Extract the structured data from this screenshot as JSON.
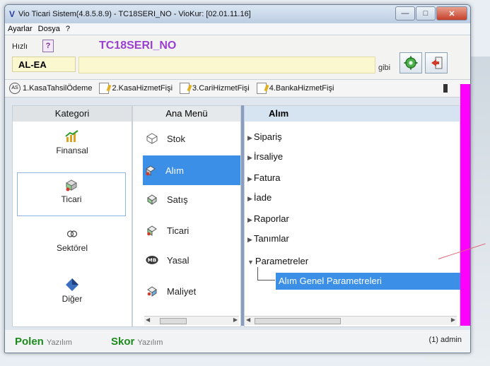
{
  "window": {
    "title": "Vio Ticari Sistem(4.8.5.8.9)  - TC18SERI_NO - VioKur: [02.01.11.16]"
  },
  "menubar": [
    "Ayarlar",
    "Dosya",
    "?"
  ],
  "header": {
    "hizli_label": "Hızlı",
    "help_label": "?",
    "code_title": "TC18SERI_NO",
    "company_field": "AL-EA",
    "gibi_label": "gibi",
    "title_color": "#9a3fd0"
  },
  "quickbar": [
    {
      "label": "1.KasaTahsilÖdeme",
      "icon": "as-icon"
    },
    {
      "label": "2.KasaHizmetFişi",
      "icon": "document-edit-icon"
    },
    {
      "label": "3.CariHizmetFişi",
      "icon": "document-edit-icon"
    },
    {
      "label": "4.BankaHizmetFişi",
      "icon": "document-edit-icon"
    }
  ],
  "kategori": {
    "header": "Kategori",
    "items": [
      {
        "label": "Finansal",
        "icon": "chart-icon"
      },
      {
        "label": "Ticari",
        "icon": "handshake-icon",
        "selected": true
      },
      {
        "label": "Sektörel",
        "icon": "rings-icon"
      },
      {
        "label": "Diğer",
        "icon": "diamond-icon"
      }
    ]
  },
  "ana_menu": {
    "header": "Ana Menü",
    "items": [
      {
        "label": "Stok",
        "icon": "box-icon"
      },
      {
        "label": "Alım",
        "icon": "cart-icon",
        "selected": true
      },
      {
        "label": "Satış",
        "icon": "sale-icon"
      },
      {
        "label": "Ticari",
        "icon": "handshake-icon"
      },
      {
        "label": "Yasal",
        "icon": "mb-icon"
      },
      {
        "label": "Maliyet",
        "icon": "cost-icon"
      }
    ]
  },
  "tree": {
    "header": "Alım",
    "nodes": [
      {
        "label": "Sipariş",
        "expanded": false
      },
      {
        "label": "İrsaliye",
        "expanded": false
      },
      {
        "label": "Fatura",
        "expanded": false
      },
      {
        "label": "İade",
        "expanded": false
      },
      {
        "label": "Raporlar",
        "expanded": false
      },
      {
        "label": "Tanımlar",
        "expanded": false
      },
      {
        "label": "Parametreler",
        "expanded": true
      }
    ],
    "selected_leaf": "Alım Genel Parametreleri"
  },
  "status": {
    "polen": "Polen",
    "polen_yazilim": "Yazılım",
    "skor": "Skor",
    "skor_yazilim": "Yazılım",
    "user": "(1) admin"
  },
  "colors": {
    "selection": "#3b8fe6",
    "accent_magenta": "#ff00ff",
    "brand_green": "#1d8a1d"
  }
}
